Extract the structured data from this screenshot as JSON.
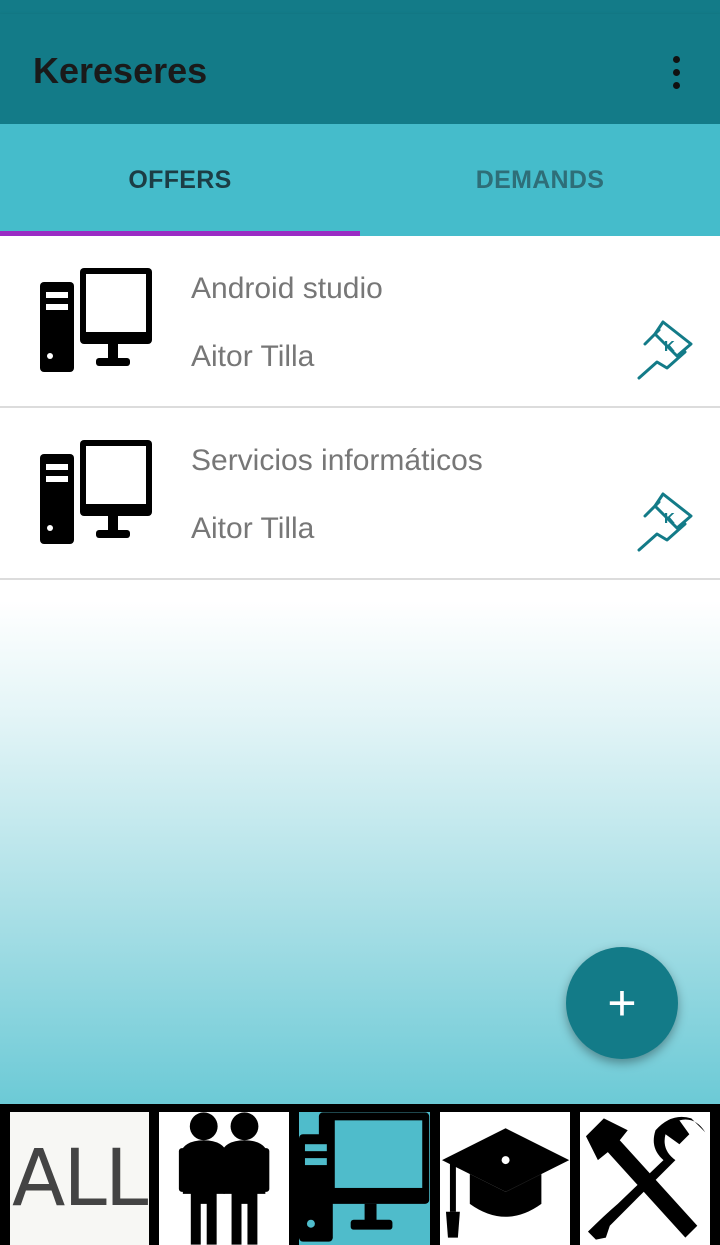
{
  "app": {
    "title": "Kereseres",
    "menu_icon": "more-vert-icon"
  },
  "tabs": [
    {
      "label": "OFFERS",
      "active": true
    },
    {
      "label": "DEMANDS",
      "active": false
    }
  ],
  "offers": [
    {
      "title": "Android studio",
      "author": "Aitor Tilla",
      "icon": "computer-icon",
      "action_icon": "pin-flag-icon"
    },
    {
      "title": "Servicios informáticos",
      "author": "Aitor Tilla",
      "icon": "computer-icon",
      "action_icon": "pin-flag-icon"
    }
  ],
  "fab": {
    "label": "+"
  },
  "categories": [
    {
      "label": "ALL",
      "icon": "all-text",
      "selected": false
    },
    {
      "label": "",
      "icon": "people-icon",
      "selected": false
    },
    {
      "label": "",
      "icon": "computer-icon",
      "selected": true
    },
    {
      "label": "",
      "icon": "graduation-cap-icon",
      "selected": false
    },
    {
      "label": "",
      "icon": "tools-icon",
      "selected": false
    }
  ],
  "colors": {
    "primary": "#137b88",
    "tab_bar": "#45bccb",
    "indicator": "#9a2bc3",
    "selected_category": "#4fbccb"
  }
}
